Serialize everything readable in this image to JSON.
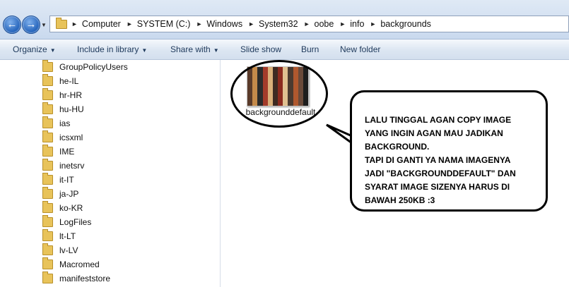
{
  "address_bar": {
    "path": [
      "Computer",
      "SYSTEM (C:)",
      "Windows",
      "System32",
      "oobe",
      "info",
      "backgrounds"
    ],
    "back_icon": "arrow-left-icon",
    "forward_icon": "arrow-right-icon",
    "separator": "►",
    "recent_caret": "▼"
  },
  "toolbar": {
    "organize": "Organize",
    "include_in_library": "Include in library",
    "share_with": "Share with",
    "slide_show": "Slide show",
    "burn": "Burn",
    "new_folder": "New folder",
    "caret": "▼"
  },
  "nav_pane": {
    "items": [
      "GroupPolicyUsers",
      "he-IL",
      "hr-HR",
      "hu-HU",
      "ias",
      "icsxml",
      "IME",
      "inetsrv",
      "it-IT",
      "ja-JP",
      "ko-KR",
      "LogFiles",
      "lt-LT",
      "lv-LV",
      "Macromed",
      "manifeststore"
    ]
  },
  "file": {
    "name": "backgrounddefault",
    "thumb_colors": [
      "#5a3b2a",
      "#c48a4a",
      "#2b2b2b",
      "#a33b2a",
      "#d9b07a",
      "#3d2a22",
      "#8b2a1e",
      "#e0c090",
      "#4a3a30",
      "#b0582e",
      "#6a4a3a",
      "#1e1e1e"
    ]
  },
  "annotation": {
    "lines": [
      "LALU TINGGAL AGAN COPY IMAGE",
      "YANG INGIN AGAN MAU JADIKAN",
      "BACKGROUND.",
      "TAPI DI GANTI YA NAMA IMAGENYA",
      "JADI \"BACKGROUNDDEFAULT\" DAN",
      "SYARAT IMAGE SIZENYA HARUS DI",
      "BAWAH 250KB :3"
    ]
  }
}
